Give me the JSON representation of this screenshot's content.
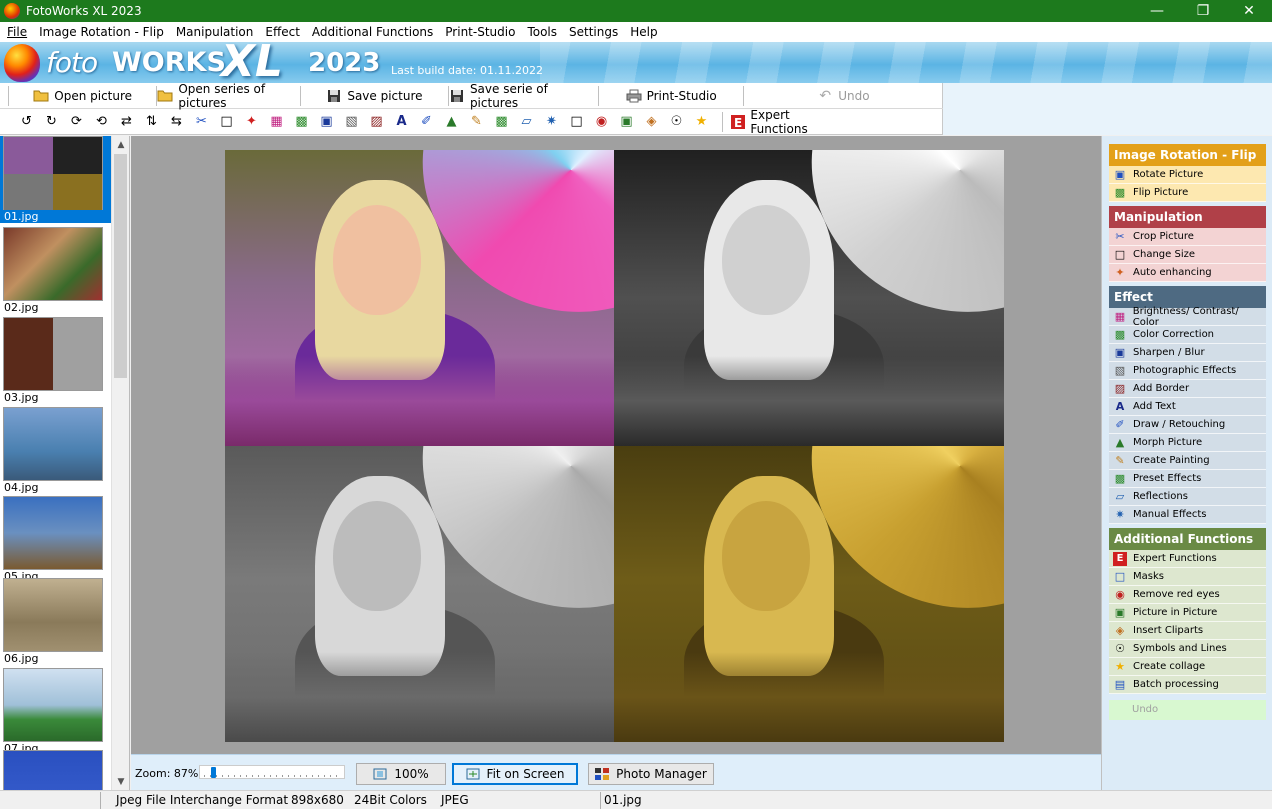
{
  "window": {
    "title": "FotoWorks XL 2023",
    "controls": [
      "minimize",
      "maximize",
      "close"
    ]
  },
  "menu": {
    "items": [
      {
        "label": "File"
      },
      {
        "label": "Image Rotation - Flip"
      },
      {
        "label": "Manipulation"
      },
      {
        "label": "Effect"
      },
      {
        "label": "Additional Functions"
      },
      {
        "label": "Print-Studio"
      },
      {
        "label": "Tools"
      },
      {
        "label": "Settings"
      },
      {
        "label": "Help"
      }
    ]
  },
  "banner": {
    "logo_foto": "foto",
    "logo_works": "WORKS",
    "logo_xl": "XL",
    "logo_year": "2023",
    "build_date": "Last build date: 01.11.2022"
  },
  "toolbar_main": {
    "open_picture": "Open picture",
    "open_series": "Open series of pictures",
    "save_picture": "Save picture",
    "save_serie": "Save serie of pictures",
    "print_studio": "Print-Studio",
    "undo": "Undo",
    "expert_functions": "Expert Functions"
  },
  "toolbar_tools": {
    "icons": [
      "rotate-left-icon",
      "rotate-90-icon",
      "rotate-cw-icon",
      "rotate-ccw-icon",
      "flip-horizontal-icon",
      "flip-vertical-icon",
      "flip-icon",
      "crop-icon",
      "resize-icon",
      "auto-enhance-icon",
      "brightness-icon",
      "color-correction-icon",
      "sharpen-icon",
      "photo-effects-icon",
      "border-icon",
      "text-icon",
      "draw-icon",
      "morph-icon",
      "painting-icon",
      "preset-effects-icon",
      "reflections-icon",
      "manual-effects-icon",
      "masks-icon",
      "red-eye-icon",
      "picture-in-picture-icon",
      "cliparts-icon",
      "symbols-icon",
      "collage-icon"
    ]
  },
  "thumbnails": [
    {
      "label": "01.jpg",
      "selected": true
    },
    {
      "label": "02.jpg",
      "selected": false
    },
    {
      "label": "03.jpg",
      "selected": false
    },
    {
      "label": "04.jpg",
      "selected": false
    },
    {
      "label": "05.jpg",
      "selected": false
    },
    {
      "label": "06.jpg",
      "selected": false
    },
    {
      "label": "07.jpg",
      "selected": false
    },
    {
      "label": "",
      "selected": false
    }
  ],
  "bottom": {
    "zoom_label": "Zoom: 87%",
    "zoom_level": 0.87,
    "btn_100": "100%",
    "btn_fit": "Fit on Screen",
    "btn_photo_manager": "Photo Manager"
  },
  "right_panel": {
    "groups": [
      {
        "title": "Image Rotation - Flip",
        "color": "#e3a019",
        "bg": "#fde8b0",
        "items": [
          {
            "label": "Rotate Picture",
            "icon": "rotate-picture-icon"
          },
          {
            "label": "Flip Picture",
            "icon": "flip-picture-icon"
          }
        ]
      },
      {
        "title": "Manipulation",
        "color": "#b04040",
        "bg": "#f3d3d3",
        "items": [
          {
            "label": "Crop Picture",
            "icon": "crop-icon"
          },
          {
            "label": "Change Size",
            "icon": "resize-icon"
          },
          {
            "label": "Auto enhancing",
            "icon": "auto-enhance-icon"
          }
        ]
      },
      {
        "title": "Effect",
        "color": "#4e6a82",
        "bg": "#d2dde7",
        "items": [
          {
            "label": "Brightness/ Contrast/ Color",
            "icon": "brightness-icon"
          },
          {
            "label": "Color Correction",
            "icon": "color-correction-icon"
          },
          {
            "label": "Sharpen / Blur",
            "icon": "sharpen-icon"
          },
          {
            "label": "Photographic Effects",
            "icon": "camera-icon"
          },
          {
            "label": "Add Border",
            "icon": "border-icon"
          },
          {
            "label": "Add Text",
            "icon": "text-icon"
          },
          {
            "label": "Draw / Retouching",
            "icon": "draw-icon"
          },
          {
            "label": "Morph Picture",
            "icon": "morph-icon"
          },
          {
            "label": "Create Painting",
            "icon": "painting-icon"
          },
          {
            "label": "Preset Effects",
            "icon": "preset-effects-icon"
          },
          {
            "label": "Reflections",
            "icon": "reflections-icon"
          },
          {
            "label": "Manual Effects",
            "icon": "manual-effects-icon"
          }
        ]
      },
      {
        "title": "Additional Functions",
        "color": "#6a8a45",
        "bg": "#dde7cf",
        "items": [
          {
            "label": "Expert Functions",
            "icon": "expert-icon"
          },
          {
            "label": "Masks",
            "icon": "masks-icon"
          },
          {
            "label": "Remove red eyes",
            "icon": "red-eye-icon"
          },
          {
            "label": "Picture in Picture",
            "icon": "picture-in-picture-icon"
          },
          {
            "label": "Insert Cliparts",
            "icon": "cliparts-icon"
          },
          {
            "label": "Symbols and Lines",
            "icon": "symbols-icon"
          },
          {
            "label": "Create collage",
            "icon": "star-icon"
          },
          {
            "label": "Batch processing",
            "icon": "batch-icon"
          }
        ]
      }
    ],
    "undo_label": "Undo"
  },
  "status": {
    "format": "Jpeg File Interchange Format",
    "dimensions": "898x680",
    "colors": "24Bit Colors",
    "type": "JPEG",
    "filename": "01.jpg"
  }
}
